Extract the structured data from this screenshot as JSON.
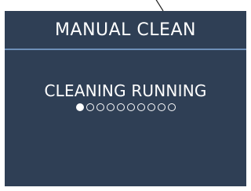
{
  "screen": {
    "title": "MANUAL CLEAN",
    "status": "CLEANING RUNNING",
    "progress": {
      "current_step": 1,
      "total_steps": 10
    }
  },
  "colors": {
    "background": "#2f3f55",
    "divider": "#6e8fb8",
    "text": "#ffffff"
  }
}
